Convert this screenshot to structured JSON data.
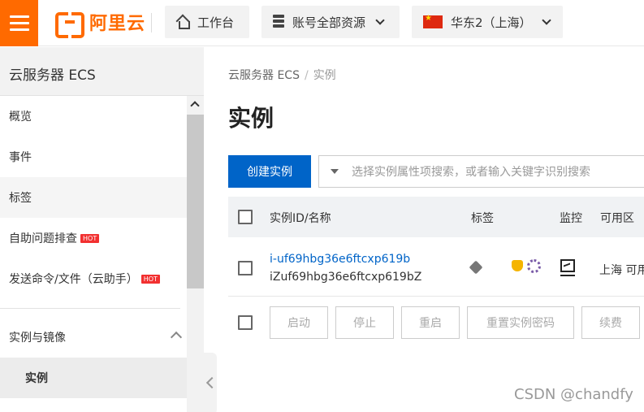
{
  "header": {
    "logo_text": "阿里云",
    "workbench_label": "工作台",
    "resources_label": "账号全部资源",
    "region_label": "华东2（上海）"
  },
  "sidebar": {
    "title": "云服务器 ECS",
    "items": [
      {
        "label": "概览"
      },
      {
        "label": "事件"
      },
      {
        "label": "标签"
      },
      {
        "label": "自助问题排查",
        "badge": "HOT"
      },
      {
        "label": "发送命令/文件（云助手）",
        "badge": "HOT"
      }
    ],
    "section_label": "实例与镜像",
    "active_item": "实例"
  },
  "main": {
    "breadcrumb": [
      "云服务器 ECS",
      "实例"
    ],
    "breadcrumb_sep": "/",
    "title": "实例",
    "create_button": "创建实例",
    "search_placeholder": "选择实例属性项搜索，或者输入关键字识别搜索",
    "columns": [
      "实例ID/名称",
      "标签",
      "监控",
      "可用区"
    ],
    "row": {
      "instance_id": "i-uf69hbg36e6ftcxp619b",
      "instance_name": "iZuf69hbg36e6ftcxp619bZ",
      "zone": "上海 可用"
    },
    "actions": [
      "启动",
      "停止",
      "重启",
      "重置实例密码",
      "续费"
    ]
  },
  "watermark": "CSDN @chandfy"
}
